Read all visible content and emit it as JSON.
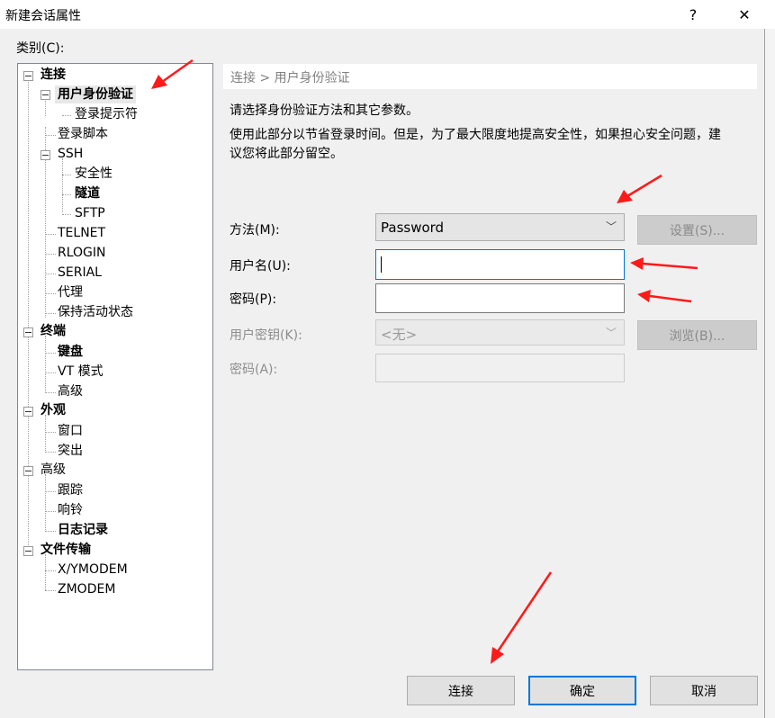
{
  "window": {
    "title": "新建会话属性",
    "help_label": "?",
    "close_label": "✕"
  },
  "category": {
    "label": "类别(C):",
    "tree": [
      {
        "label": "连接"
      },
      {
        "label": "用户身份验证"
      },
      {
        "label": "登录提示符"
      },
      {
        "label": "登录脚本"
      },
      {
        "label": "SSH"
      },
      {
        "label": "安全性"
      },
      {
        "label": "隧道"
      },
      {
        "label": "SFTP"
      },
      {
        "label": "TELNET"
      },
      {
        "label": "RLOGIN"
      },
      {
        "label": "SERIAL"
      },
      {
        "label": "代理"
      },
      {
        "label": "保持活动状态"
      },
      {
        "label": "终端"
      },
      {
        "label": "键盘"
      },
      {
        "label": "VT 模式"
      },
      {
        "label": "高级"
      },
      {
        "label": "外观"
      },
      {
        "label": "窗口"
      },
      {
        "label": "突出"
      },
      {
        "label": "高级"
      },
      {
        "label": "跟踪"
      },
      {
        "label": "响铃"
      },
      {
        "label": "日志记录"
      },
      {
        "label": "文件传输"
      },
      {
        "label": "X/YMODEM"
      },
      {
        "label": "ZMODEM"
      }
    ]
  },
  "panel": {
    "breadcrumb": "连接 > 用户身份验证",
    "intro": "请选择身份验证方法和其它参数。",
    "note_line1": "使用此部分以节省登录时间。但是，为了最大限度地提高安全性，如果担心安全问题，建",
    "note_line2": "议您将此部分留空。",
    "method_label": "方法(M):",
    "method_value": "Password",
    "settings_button": "设置(S)...",
    "username_label": "用户名(U):",
    "username_value": "",
    "password_label": "密码(P):",
    "password_value": "",
    "userkey_label": "用户密钥(K):",
    "userkey_value": "<无>",
    "browse_button": "浏览(B)...",
    "passphrase_label": "密码(A):",
    "passphrase_value": ""
  },
  "footer": {
    "connect": "连接",
    "ok": "确定",
    "cancel": "取消"
  },
  "colors": {
    "annotation_arrow": "#ff1a1a",
    "focus_border": "#0078d7"
  }
}
